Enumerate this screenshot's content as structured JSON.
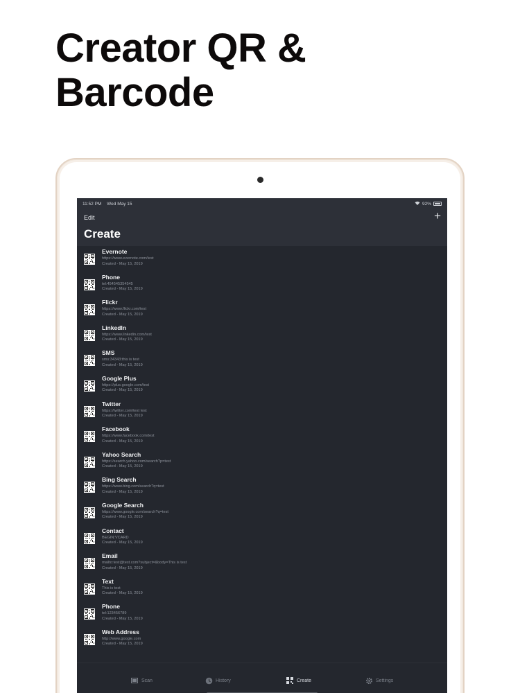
{
  "headline": {
    "line1": "Creator QR &",
    "line2": "Barcode"
  },
  "status_bar": {
    "time": "11:52 PM",
    "date": "Wed May 15",
    "battery": "92%"
  },
  "nav": {
    "edit_label": "Edit",
    "add_label": "+",
    "title": "Create"
  },
  "items": [
    {
      "title": "Evernote",
      "content": "https://www.evernote.com/test",
      "created": "Created - May 15, 2019"
    },
    {
      "title": "Phone",
      "content": "tel:454545354545",
      "created": "Created - May 15, 2019"
    },
    {
      "title": "Flickr",
      "content": "https://www.flickr.com/test",
      "created": "Created - May 15, 2019"
    },
    {
      "title": "LinkedIn",
      "content": "https://www.linkedin.com/test",
      "created": "Created - May 15, 2019"
    },
    {
      "title": "SMS",
      "content": "sms:34343:this is test",
      "created": "Created - May 15, 2019"
    },
    {
      "title": "Google Plus",
      "content": "https://plus.google.com/test",
      "created": "Created - May 15, 2019"
    },
    {
      "title": "Twitter",
      "content": "https://twitter.com/test test",
      "created": "Created - May 15, 2019"
    },
    {
      "title": "Facebook",
      "content": "https://www.facebook.com/test",
      "created": "Created - May 15, 2019"
    },
    {
      "title": "Yahoo Search",
      "content": "https://search.yahoo.com/search?p=test",
      "created": "Created - May 15, 2019"
    },
    {
      "title": "Bing Search",
      "content": "https://www.bing.com/search?q=test",
      "created": "Created - May 15, 2019"
    },
    {
      "title": "Google Search",
      "content": "https://www.google.com/search?q=test",
      "created": "Created - May 15, 2019"
    },
    {
      "title": "Contact",
      "content": "BEGIN:VCARD",
      "created": "Created - May 15, 2019"
    },
    {
      "title": "Email",
      "content": "mailto:test@test.com?subject=&body=This is test",
      "created": "Created - May 15, 2019"
    },
    {
      "title": "Text",
      "content": "This is test",
      "created": "Created - May 15, 2019"
    },
    {
      "title": "Phone",
      "content": "tel:123456789",
      "created": "Created - May 15, 2019"
    },
    {
      "title": "Web Address",
      "content": "http://www.google.com",
      "created": "Created - May 15, 2019"
    }
  ],
  "tabs": [
    {
      "label": "Scan",
      "icon": "scan-icon",
      "active": false
    },
    {
      "label": "History",
      "icon": "history-icon",
      "active": false
    },
    {
      "label": "Create",
      "icon": "qr-create-icon",
      "active": true
    },
    {
      "label": "Settings",
      "icon": "gear-icon",
      "active": false
    }
  ]
}
